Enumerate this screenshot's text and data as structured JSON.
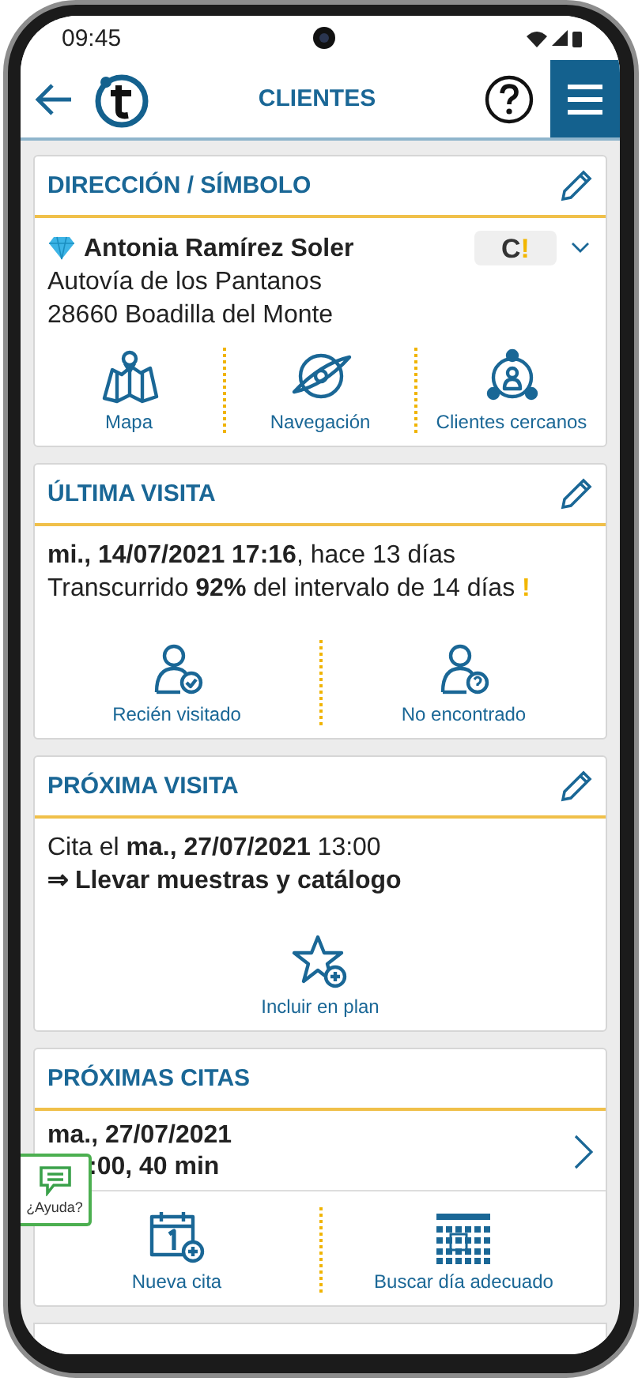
{
  "status_bar": {
    "time": "09:45"
  },
  "header": {
    "title": "CLIENTES"
  },
  "address_card": {
    "title": "DIRECCIÓN / SÍMBOLO",
    "client_name": "Antonia Ramírez Soler",
    "badge_letter": "C",
    "badge_mark": "!",
    "address_lines": [
      "Autovía de los Pantanos",
      "28660 Boadilla del Monte"
    ],
    "actions": [
      {
        "kind": "map",
        "label": "Mapa"
      },
      {
        "kind": "navigation",
        "label": "Navegación"
      },
      {
        "kind": "nearby",
        "label": "Clientes cercanos"
      }
    ]
  },
  "last_visit": {
    "title": "ÚLTIMA VISITA",
    "lines": [
      "**mi., 14/07/2021 17:16**, hace 13 días",
      "Transcurrido **92%** del intervalo de 14 días"
    ],
    "warning": "!",
    "actions": [
      {
        "kind": "visited",
        "label": "Recién visitado"
      },
      {
        "kind": "not_found",
        "label": "No encontrado"
      }
    ]
  },
  "next_visit": {
    "title": "PRÓXIMA VISITA",
    "appointment": "Cita el **ma., 27/07/2021** 13:00",
    "task": "⇒ Llevar muestras y catálogo",
    "actions": [
      {
        "kind": "plan",
        "label": "Incluir en plan"
      }
    ]
  },
  "upcoming": {
    "title": "PRÓXIMAS CITAS",
    "appointments": [
      {
        "date": "ma., 27/07/2021",
        "detail": ":00, 40 min"
      }
    ],
    "actions": [
      {
        "kind": "new",
        "label": "Nueva cita"
      },
      {
        "kind": "find_day",
        "label": "Buscar día adecuado"
      }
    ]
  },
  "help": {
    "label": "¿Ayuda?"
  }
}
